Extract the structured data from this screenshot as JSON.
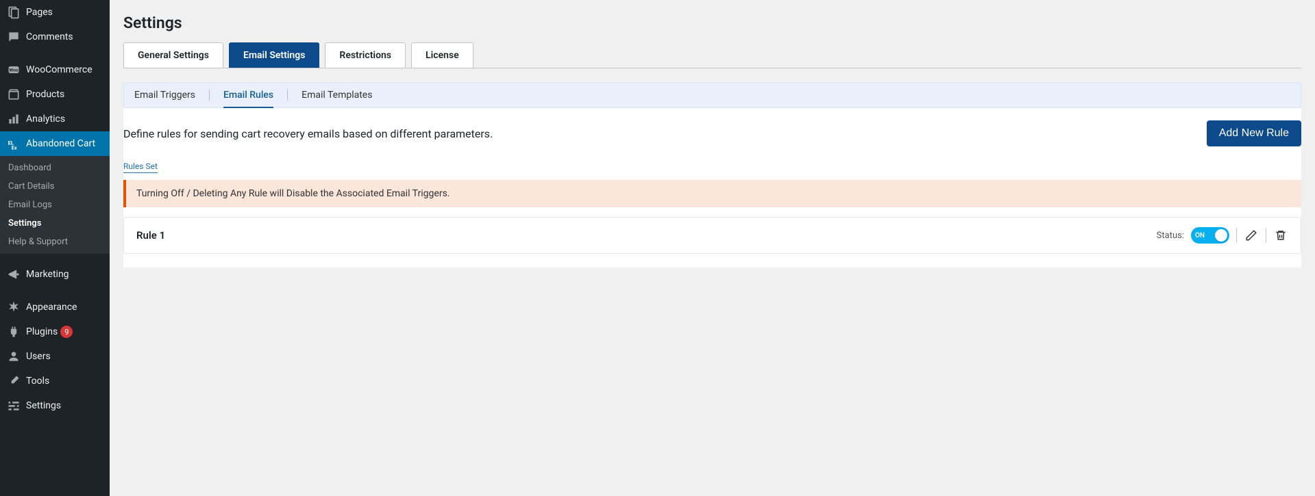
{
  "sidebar": {
    "items": [
      {
        "label": "Pages",
        "icon": "pages"
      },
      {
        "label": "Comments",
        "icon": "comments"
      },
      {
        "label": "WooCommerce",
        "icon": "woocommerce"
      },
      {
        "label": "Products",
        "icon": "products"
      },
      {
        "label": "Analytics",
        "icon": "analytics"
      },
      {
        "label": "Abandoned Cart",
        "icon": "elex",
        "current": true
      },
      {
        "label": "Marketing",
        "icon": "marketing"
      },
      {
        "label": "Appearance",
        "icon": "appearance"
      },
      {
        "label": "Plugins",
        "icon": "plugins",
        "badge": "9"
      },
      {
        "label": "Users",
        "icon": "users"
      },
      {
        "label": "Tools",
        "icon": "tools"
      },
      {
        "label": "Settings",
        "icon": "settings"
      }
    ],
    "subitems": [
      {
        "label": "Dashboard"
      },
      {
        "label": "Cart Details"
      },
      {
        "label": "Email Logs"
      },
      {
        "label": "Settings",
        "active": true
      },
      {
        "label": "Help & Support"
      }
    ]
  },
  "page": {
    "title": "Settings"
  },
  "tabs": {
    "items": [
      {
        "label": "General Settings"
      },
      {
        "label": "Email Settings",
        "active": true
      },
      {
        "label": "Restrictions"
      },
      {
        "label": "License"
      }
    ]
  },
  "subtabs": {
    "items": [
      {
        "label": "Email Triggers"
      },
      {
        "label": "Email Rules",
        "active": true
      },
      {
        "label": "Email Templates"
      }
    ]
  },
  "content": {
    "description": "Define rules for sending cart recovery emails based on different parameters.",
    "add_button": "Add New Rule",
    "rules_set_label": "Rules Set",
    "warning": "Turning Off / Deleting Any Rule will Disable the Associated Email Triggers.",
    "rules": [
      {
        "name": "Rule 1",
        "status_label": "Status:",
        "toggle_text": "ON"
      }
    ]
  }
}
